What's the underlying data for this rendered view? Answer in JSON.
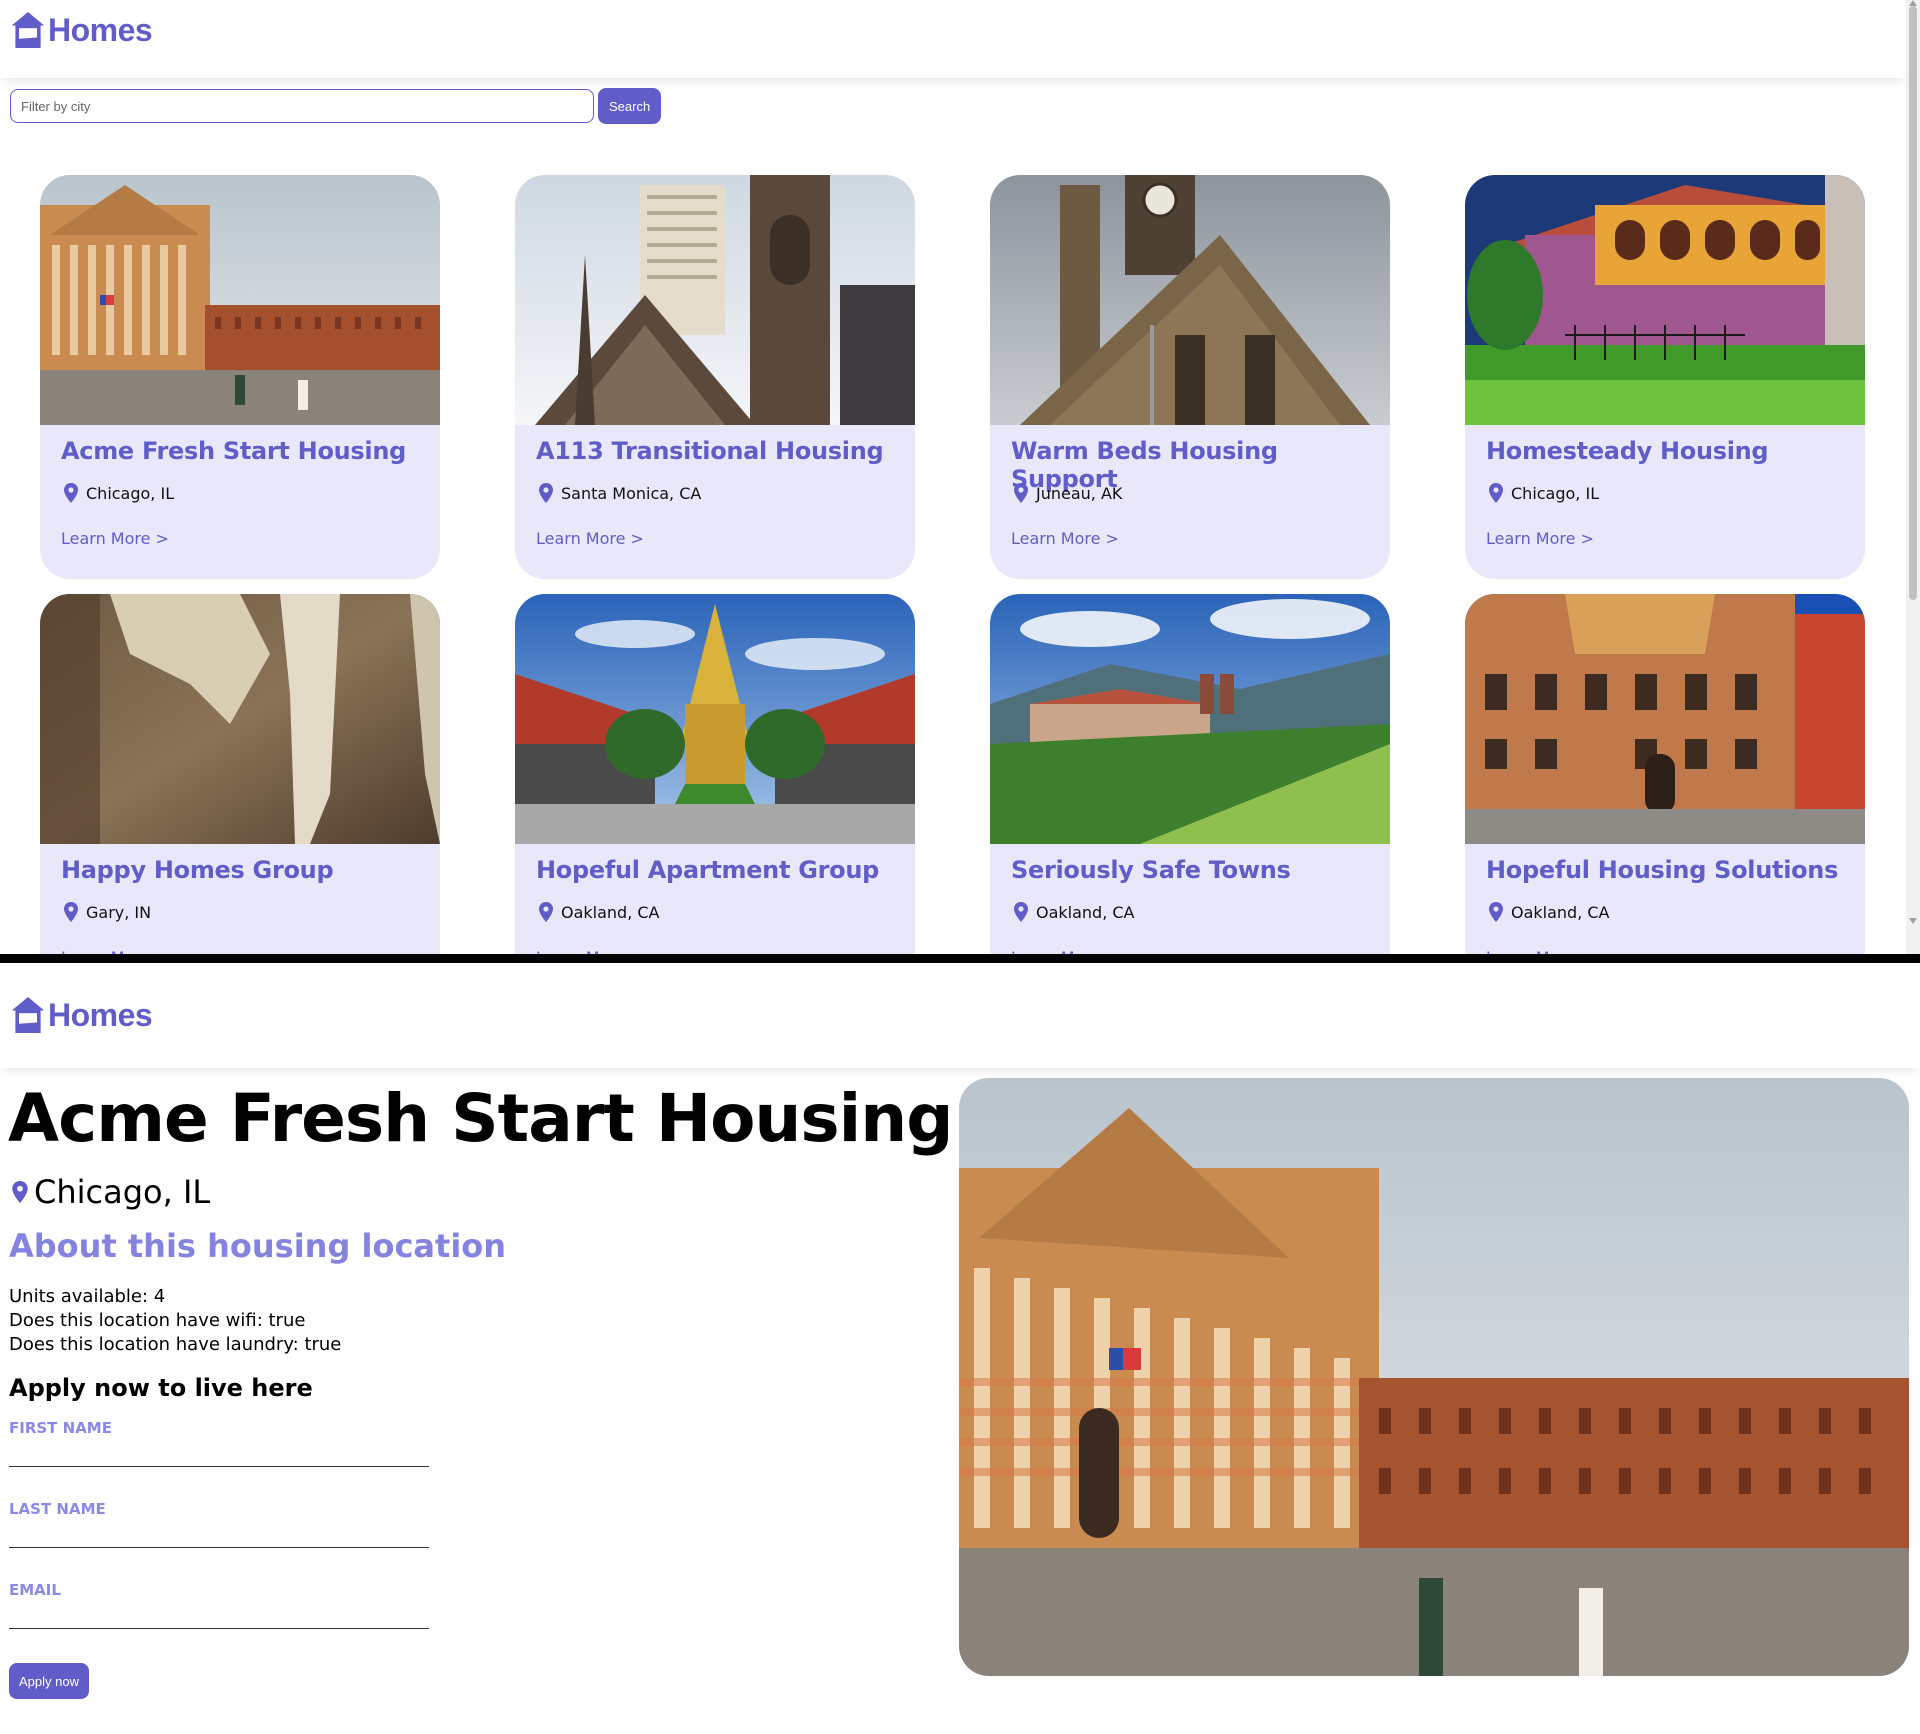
{
  "brand": {
    "name": "Homes",
    "primary_color": "#605DC8",
    "card_background": "#E8E8FA",
    "label_color": "#8B89E6"
  },
  "listing_page": {
    "search": {
      "placeholder": "Filter by city",
      "button_label": "Search"
    },
    "link_label": "Learn More >",
    "cards": [
      {
        "name": "Acme Fresh Start Housing",
        "location": "Chicago, IL",
        "photo": "plaza-building-photo"
      },
      {
        "name": "A113 Transitional Housing",
        "location": "Santa Monica, CA",
        "photo": "church-tower-photo"
      },
      {
        "name": "Warm Beds Housing Support",
        "location": "Juneau, AK",
        "photo": "stone-church-photo"
      },
      {
        "name": "Homesteady Housing",
        "location": "Chicago, IL",
        "photo": "villa-garden-photo"
      },
      {
        "name": "Happy Homes Group",
        "location": "Gary, IN",
        "photo": "peeling-wall-photo"
      },
      {
        "name": "Hopeful Apartment Group",
        "location": "Oakland, CA",
        "photo": "temple-photo"
      },
      {
        "name": "Seriously Safe Towns",
        "location": "Oakland, CA",
        "photo": "valley-town-photo"
      },
      {
        "name": "Hopeful Housing Solutions",
        "location": "Oakland, CA",
        "photo": "town-hall-photo"
      }
    ]
  },
  "detail_page": {
    "title": "Acme Fresh Start Housing",
    "location": "Chicago, IL",
    "about_heading": "About this housing location",
    "features": [
      "Units available: 4",
      "Does this location have wifi: true",
      "Does this location have laundry: true"
    ],
    "apply_heading": "Apply now to live here",
    "form": {
      "first_name_label": "FIRST NAME",
      "last_name_label": "LAST NAME",
      "email_label": "EMAIL",
      "first_name_value": "",
      "last_name_value": "",
      "email_value": "",
      "submit_label": "Apply now"
    },
    "photo": "plaza-building-photo"
  }
}
